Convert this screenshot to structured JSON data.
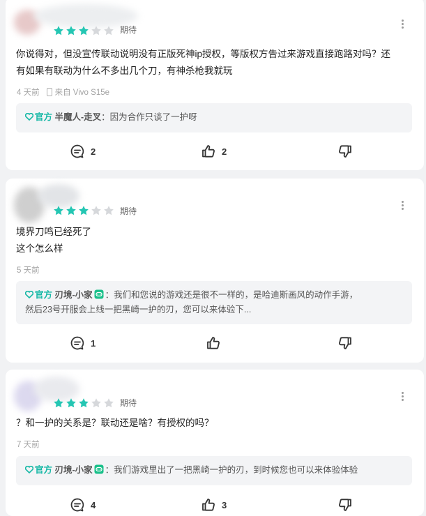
{
  "theme": {
    "accent": "#17b8a6",
    "star_on": "#24c6b3",
    "star_off": "#d6d8db"
  },
  "reviews": [
    {
      "stars": 3,
      "tag": "期待",
      "content_lines": [
        "你说得对，但没宣传联动说明没有正版死神ip授权，等版权方告过来游戏直接跑路对吗？还",
        "有如果有联动为什么不多出几个刀，有神杀枪我就玩"
      ],
      "time": "4 天前",
      "device": "来自 Vivo S15e",
      "reply": {
        "official_label": "官方",
        "name": "半魔人-走叉",
        "text": "：因为合作只谈了一护呀"
      },
      "comments": "2",
      "likes": "2",
      "dislikes": ""
    },
    {
      "stars": 3,
      "tag": "期待",
      "content_lines": [
        "境界刀鸣已经死了",
        "这个怎么样"
      ],
      "time": "5 天前",
      "device": "",
      "reply": {
        "official_label": "官方",
        "name": "刃境-小家",
        "text": "：我们和您说的游戏还是很不一样的，是哈迪斯画风的动作手游，",
        "text2": "然后23号开服会上线一把黑崎一护的刃，您可以来体验下..."
      },
      "comments": "1",
      "likes": "",
      "dislikes": ""
    },
    {
      "stars": 3,
      "tag": "期待",
      "content_lines": [
        "？和一护的关系是？联动还是啥？有授权的吗？"
      ],
      "time": "7 天前",
      "device": "",
      "reply": {
        "official_label": "官方",
        "name": "刃境-小家",
        "text": "：我们游戏里出了一把黑崎一护的刃，到时候您也可以来体验体验"
      },
      "comments": "4",
      "likes": "3",
      "dislikes": ""
    }
  ]
}
